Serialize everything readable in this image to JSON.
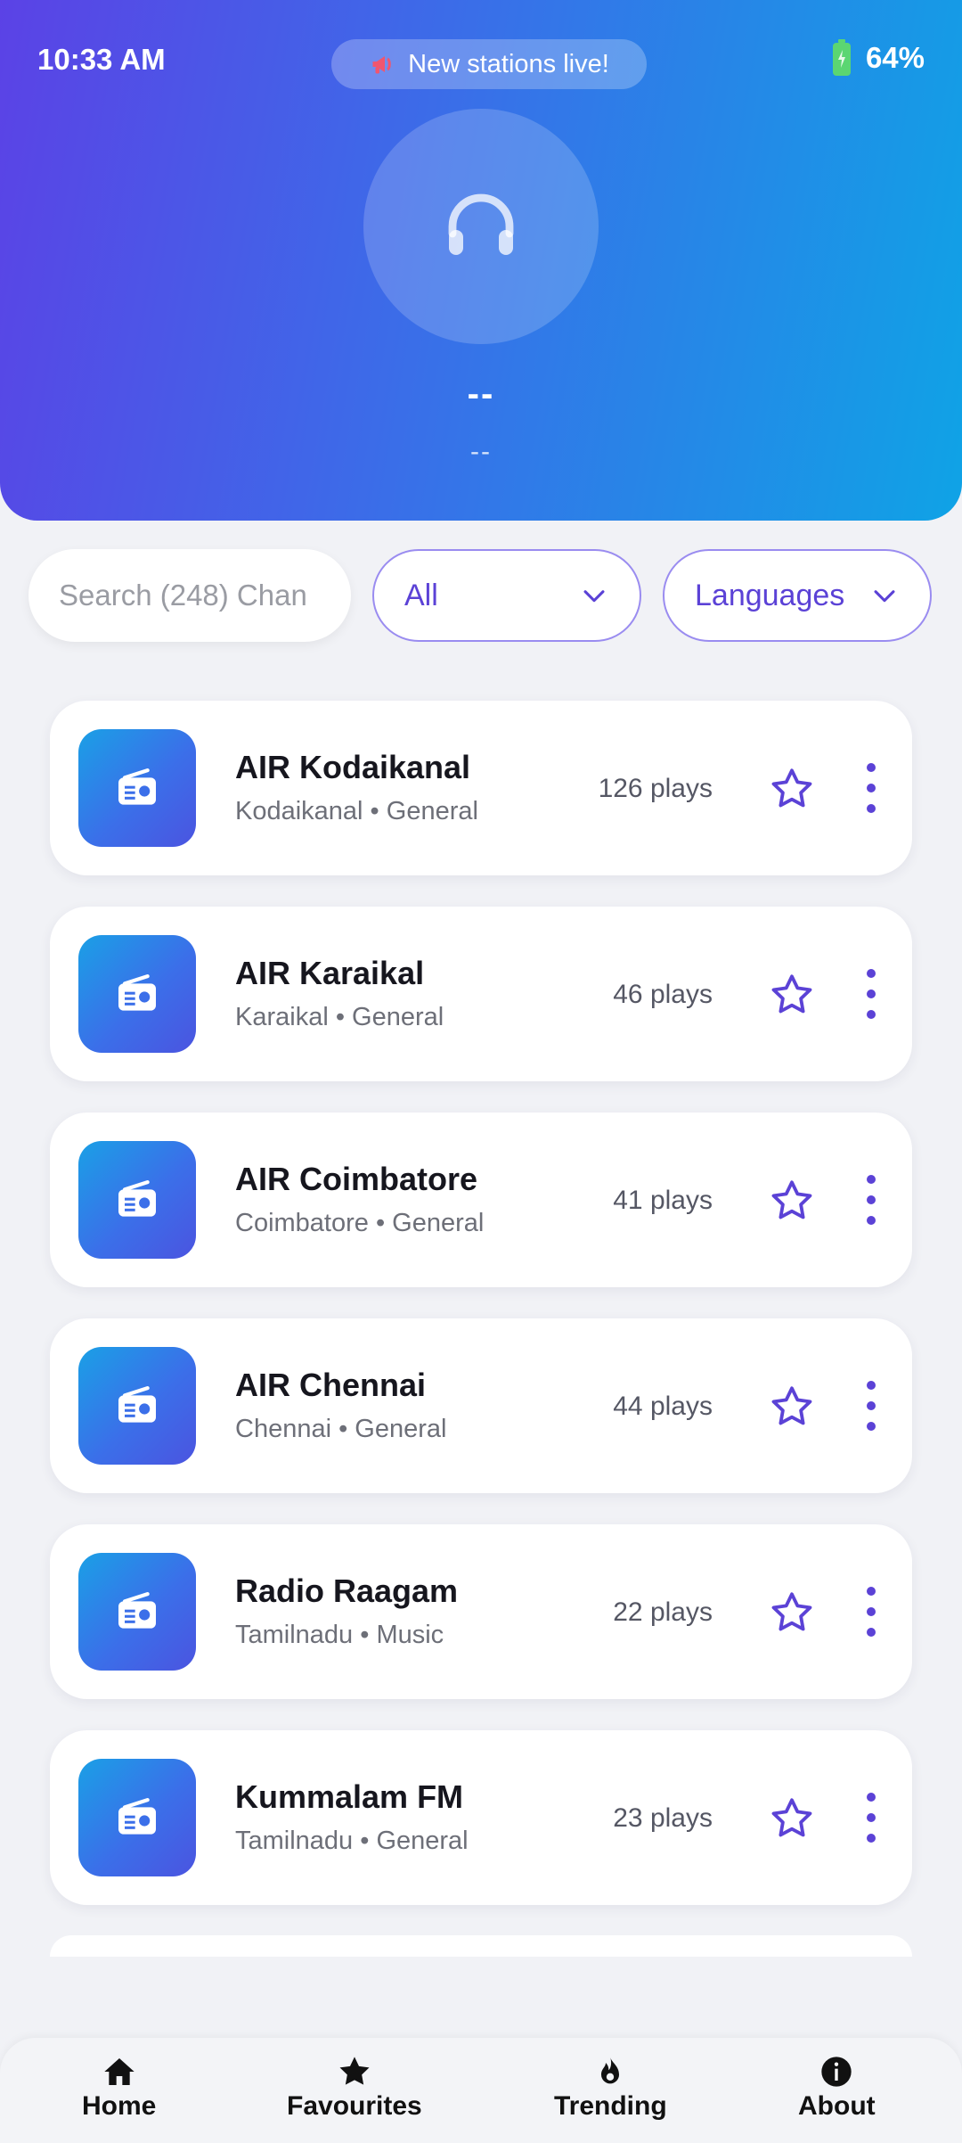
{
  "status": {
    "time": "10:33 AM",
    "battery": "64%"
  },
  "banner": {
    "text": "New stations live!"
  },
  "now_playing": {
    "title": "--",
    "subtitle": "--"
  },
  "filters": {
    "search_placeholder": "Search (248) Chan",
    "category": "All",
    "language": "Languages"
  },
  "stations": [
    {
      "name": "AIR Kodaikanal",
      "meta": "Kodaikanal • General",
      "plays": "126 plays"
    },
    {
      "name": "AIR Karaikal",
      "meta": "Karaikal • General",
      "plays": "46 plays"
    },
    {
      "name": "AIR Coimbatore",
      "meta": "Coimbatore • General",
      "plays": "41 plays"
    },
    {
      "name": "AIR Chennai",
      "meta": "Chennai • General",
      "plays": "44 plays"
    },
    {
      "name": "Radio Raagam",
      "meta": "Tamilnadu • Music",
      "plays": "22 plays"
    },
    {
      "name": "Kummalam FM",
      "meta": "Tamilnadu • General",
      "plays": "23 plays"
    }
  ],
  "nav": {
    "home": "Home",
    "favourites": "Favourites",
    "trending": "Trending",
    "about": "About"
  },
  "colors": {
    "accent": "#5b42d6",
    "header_start": "#5b42e6",
    "header_end": "#0fa3e6",
    "battery": "#5bd672"
  }
}
